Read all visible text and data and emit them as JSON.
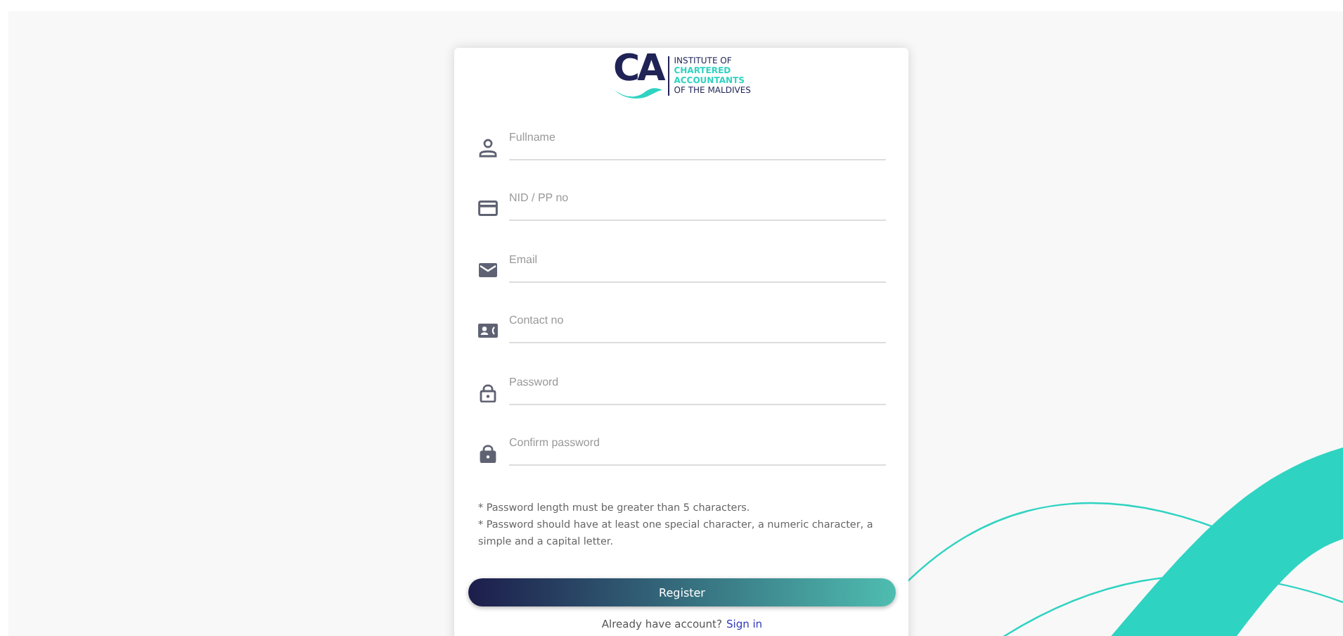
{
  "logo": {
    "mark": "CA",
    "lines": [
      {
        "text": "INSTITUTE OF",
        "highlight": false
      },
      {
        "text": "CHARTERED",
        "highlight": true
      },
      {
        "text": "ACCOUNTANTS",
        "highlight": true
      },
      {
        "text": "OF THE MALDIVES",
        "highlight": false
      }
    ]
  },
  "fields": [
    {
      "kind": "person",
      "placeholder": "Fullname"
    },
    {
      "kind": "card",
      "placeholder": "NID / PP no"
    },
    {
      "kind": "mail",
      "placeholder": "Email"
    },
    {
      "kind": "contact",
      "placeholder": "Contact no"
    },
    {
      "kind": "lock-open",
      "placeholder": "Password"
    },
    {
      "kind": "lock",
      "placeholder": "Confirm password"
    }
  ],
  "notes": [
    "* Password length must be greater than 5 characters.",
    "* Password should have at least one special character, a numeric character, a simple and a capital letter."
  ],
  "register_button": "Register",
  "footer": {
    "text": "Already have account?",
    "link": "Sign in"
  }
}
